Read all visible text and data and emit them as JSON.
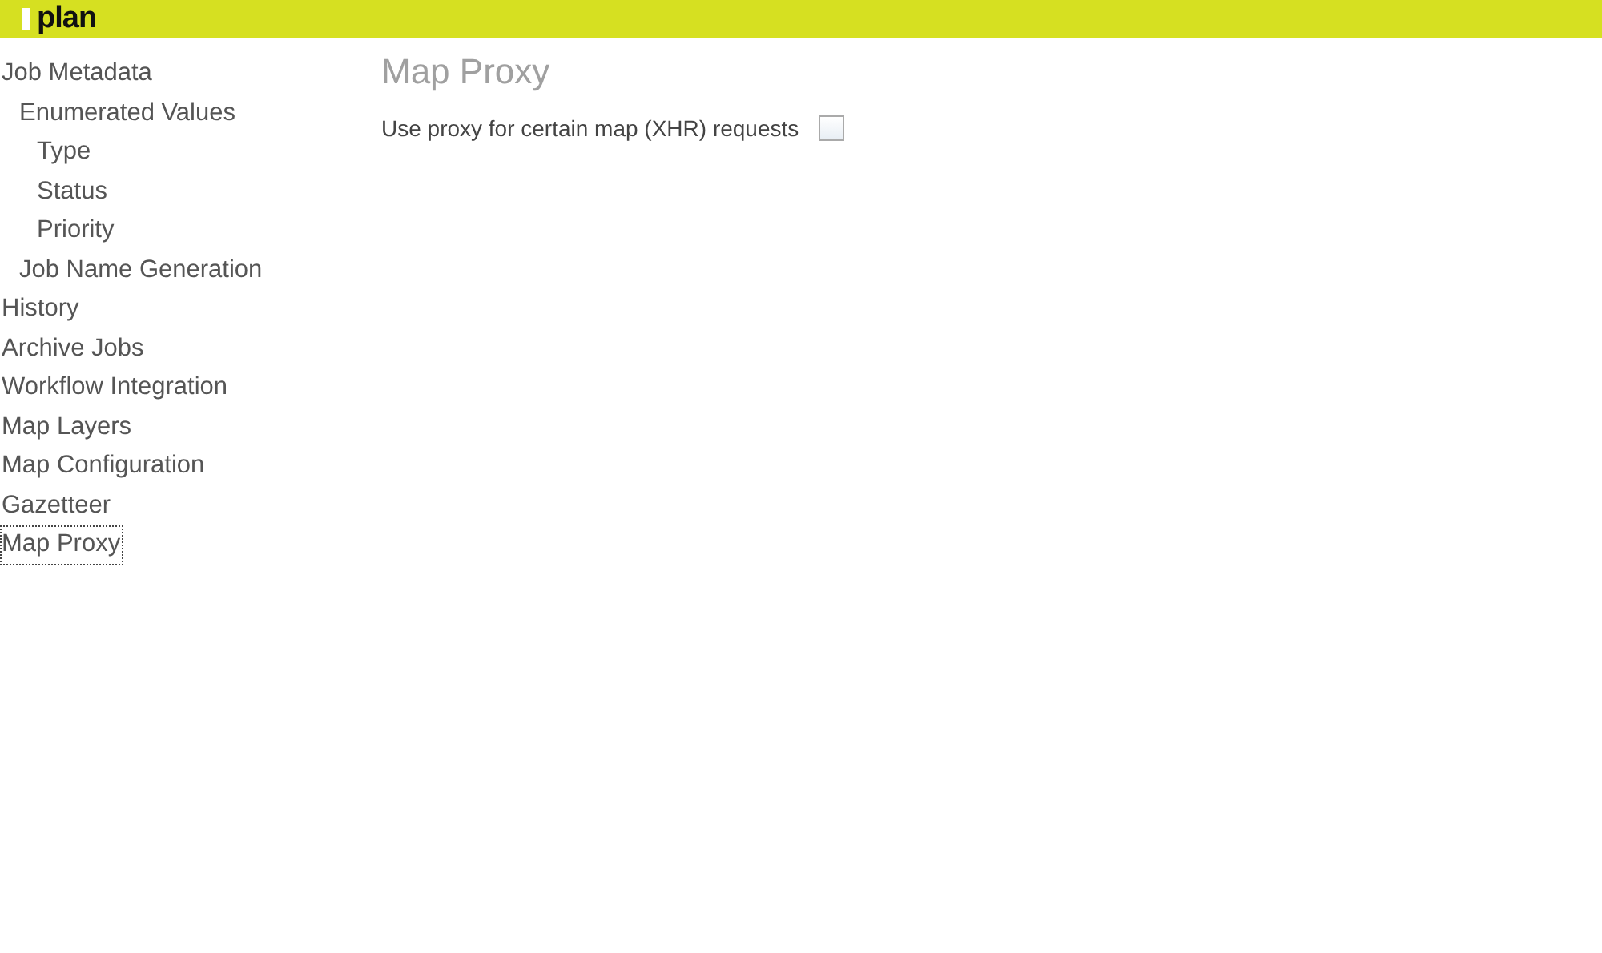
{
  "header": {
    "logo": "plan"
  },
  "sidebar": {
    "items": [
      {
        "label": "Job Metadata",
        "selected": false,
        "children": [
          {
            "label": "Enumerated Values",
            "selected": false,
            "children": [
              {
                "label": "Type",
                "selected": false
              },
              {
                "label": "Status",
                "selected": false
              },
              {
                "label": "Priority",
                "selected": false
              }
            ]
          },
          {
            "label": "Job Name Generation",
            "selected": false
          }
        ]
      },
      {
        "label": "History",
        "selected": false
      },
      {
        "label": "Archive Jobs",
        "selected": false
      },
      {
        "label": "Workflow Integration",
        "selected": false
      },
      {
        "label": "Map Layers",
        "selected": false
      },
      {
        "label": "Map Configuration",
        "selected": false
      },
      {
        "label": "Gazetteer",
        "selected": false
      },
      {
        "label": "Map Proxy",
        "selected": true
      }
    ]
  },
  "content": {
    "title": "Map Proxy",
    "option": {
      "label": "Use proxy for certain map (XHR) requests",
      "checked": false
    }
  }
}
